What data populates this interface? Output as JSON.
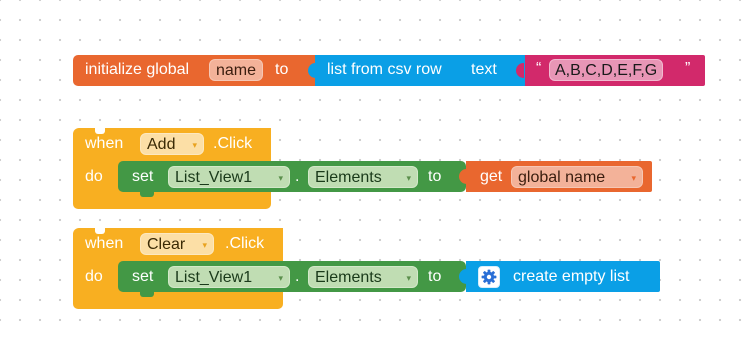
{
  "workspace": {
    "init_block": {
      "prefix": "initialize global",
      "var_name": "name",
      "to": "to",
      "csv_block": {
        "label": "list from csv row",
        "text_label": "text"
      },
      "string_block": {
        "open_quote": "“",
        "value": "A,B,C,D,E,F,G",
        "close_quote": "”"
      }
    },
    "add_event": {
      "when": "when",
      "component": "Add",
      "event": ".Click",
      "do": "do",
      "set_block": {
        "set": "set",
        "component": "List_View1",
        "dot": ".",
        "property": "Elements",
        "to": "to",
        "get_block": {
          "get": "get",
          "var_name": "global name"
        }
      }
    },
    "clear_event": {
      "when": "when",
      "component": "Clear",
      "event": ".Click",
      "do": "do",
      "set_block": {
        "set": "set",
        "component": "List_View1",
        "dot": ".",
        "property": "Elements",
        "to": "to",
        "empty_list_block": {
          "label": "create empty list",
          "icon": "gear-icon"
        }
      }
    },
    "colors": {
      "variable_orange": "#E9672F",
      "event_yellow": "#F8AF21",
      "component_green": "#439845",
      "list_blue": "#0A9FE6",
      "text_pink": "#D2296B",
      "dropdown_bg": "#C0DDB3",
      "dropdown_text": "#1A3A1A"
    },
    "dropdown_arrow": "▾"
  }
}
